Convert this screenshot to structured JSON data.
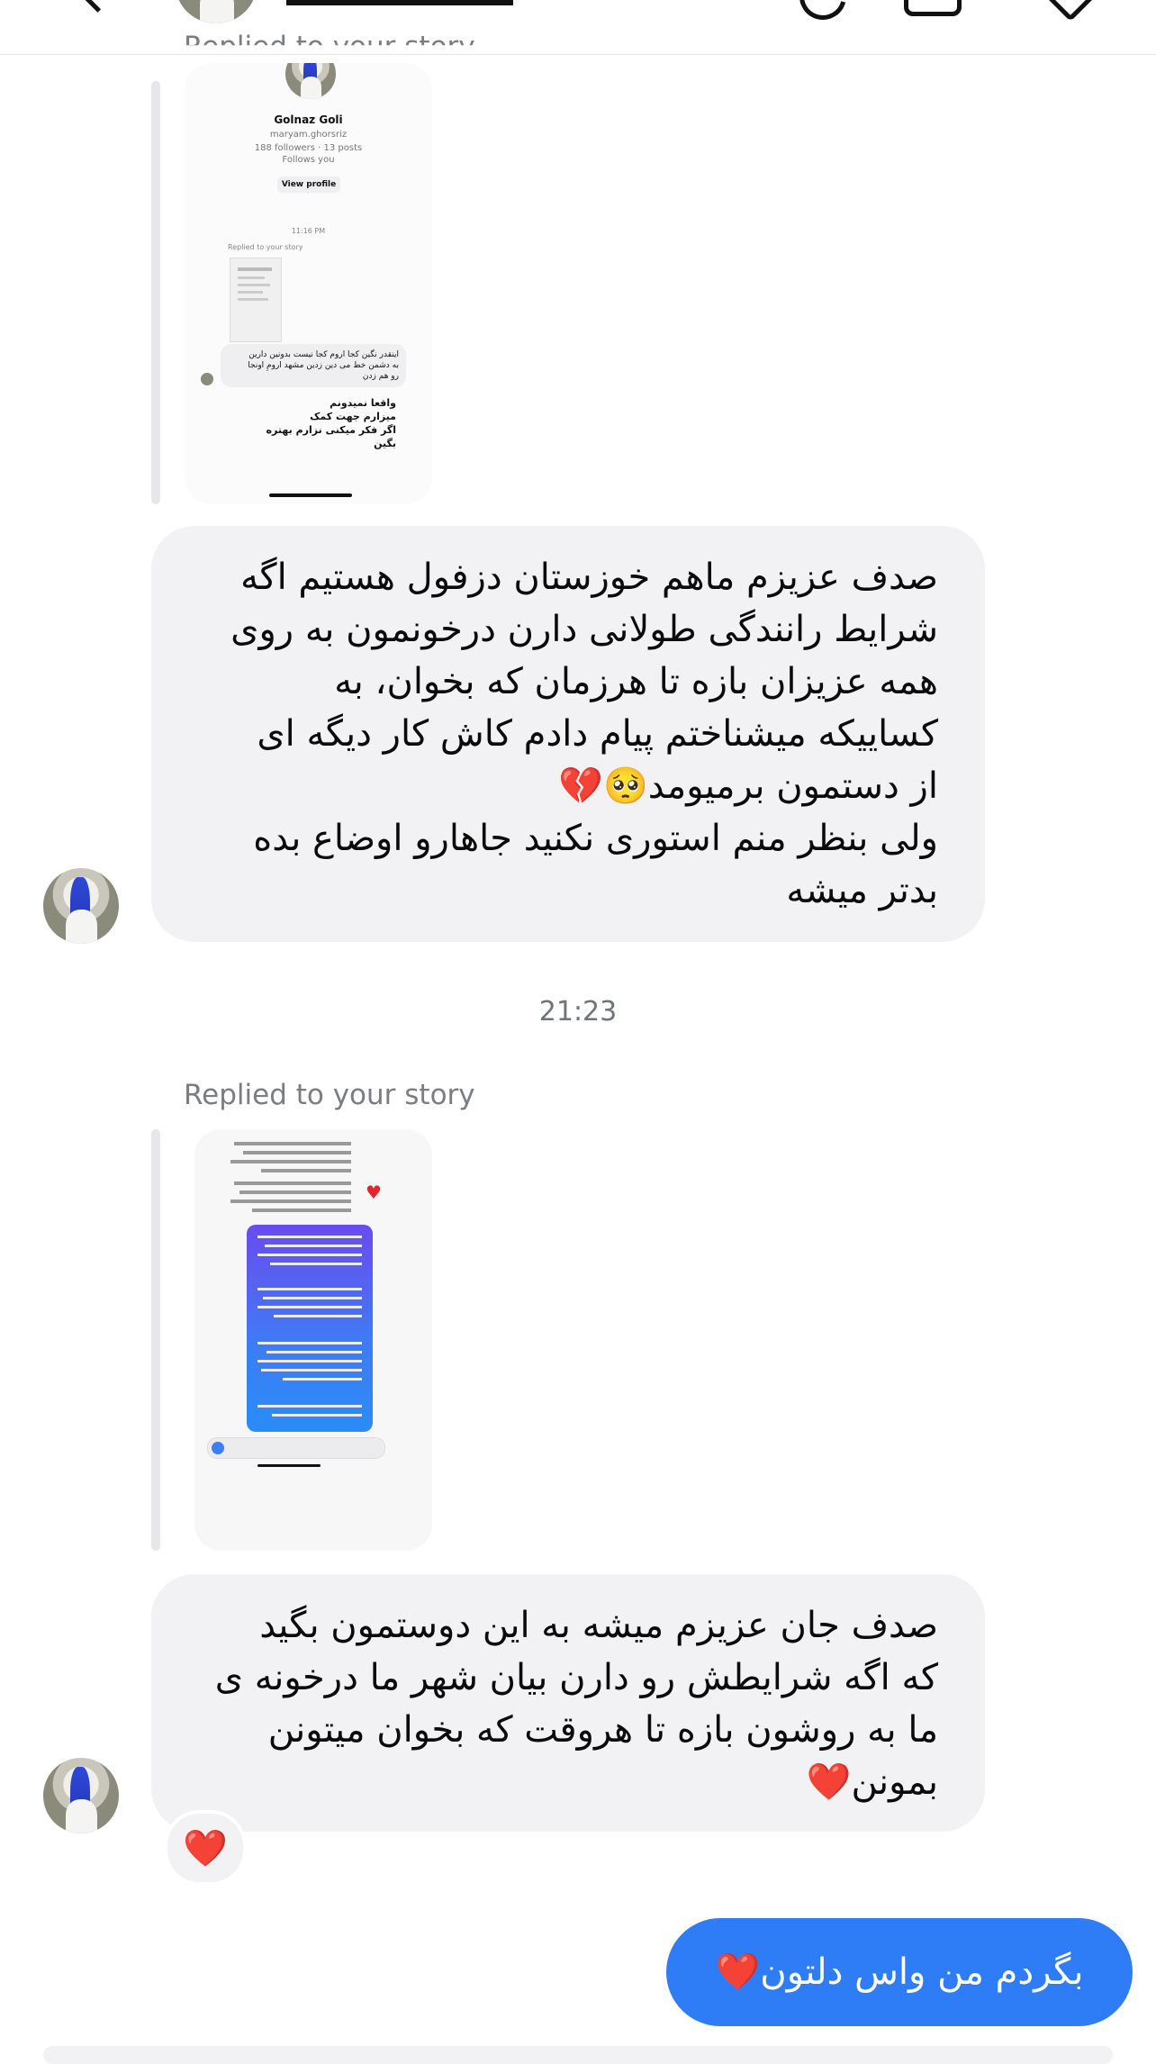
{
  "header": {
    "username_redacted": true
  },
  "messages": [
    {
      "type": "story_reply",
      "replied_label": "Replied to your story",
      "story_preview": {
        "profile_name": "Golnaz Goli",
        "handle": "maryam.ghorsriz",
        "stats": "188 followers · 13 posts",
        "follows_you": "Follows you",
        "view_profile": "View profile",
        "time": "11:16 PM",
        "inner_replied": "Replied to your story",
        "inner_bubble": "اینقدر نگین کجا اروم کجا نیست بدونین دارین\nبه دشمن خط می دین زدین مشهد ارومِ اونجا\nرو هم زدن",
        "inner_reply": "واقعا نمیدونم\nمیزارم جهت کمک\nاگر فکر میکنی نزارم بهتره\nبگین"
      }
    },
    {
      "type": "incoming_text",
      "text": "صدف عزیزم ماهم خوزستان دزفول هستیم اگه\nشرایط رانندگی طولانی دارن درخونمون به روی\nهمه عزیزان بازه تا هرزمان که بخوان، به\nکساییکه میشناختم پیام دادم کاش کار دیگه ای\nاز دستمون برمیومد🥺💔\nولی بنظر منم استوری نکنید جاهارو اوضاع بده\nبدتر میشه"
    },
    {
      "type": "timestamp",
      "text": "21:23"
    },
    {
      "type": "story_reply",
      "replied_label": "Replied to your story"
    },
    {
      "type": "incoming_text",
      "text": "صدف جان عزیزم میشه به این دوستمون بگید\nکه اگه شرایطش رو دارن بیان شهر ما درخونه ی\nما به روشون بازه تا هروقت که بخوان میتونن\nبمونن❤️",
      "reaction": "❤️"
    },
    {
      "type": "outgoing_text",
      "text": "بگردم من واس دلتون❤️"
    }
  ],
  "colors": {
    "incoming_bubble": "#f2f2f4",
    "outgoing_bubble": "#2f7df6",
    "muted_text": "#7a7d84"
  }
}
